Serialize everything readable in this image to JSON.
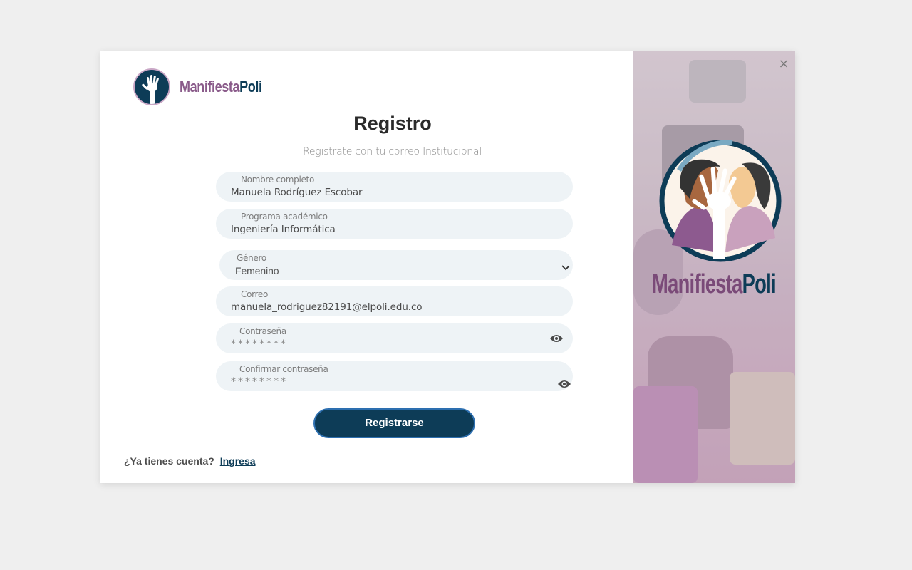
{
  "brand": {
    "name_part1": "Manifiesta",
    "name_part2": "Poli"
  },
  "title": "Registro",
  "subtitle": "Registrate con tu correo Institucional",
  "fields": {
    "full_name": {
      "label": "Nombre completo",
      "value": "Manuela Rodríguez Escobar"
    },
    "program": {
      "label": "Programa académico",
      "value": "Ingeniería Informática"
    },
    "gender": {
      "label": "Género",
      "value": "Femenino"
    },
    "email": {
      "label": "Correo",
      "value": "manuela_rodriguez82191@elpoli.edu.co"
    },
    "password": {
      "label": "Contraseña",
      "value": "********"
    },
    "confirm_password": {
      "label": "Confirmar contraseña",
      "value": "********"
    }
  },
  "submit_label": "Registrarse",
  "footer": {
    "prompt": "¿Ya tienes cuenta?",
    "link": "Ingresa"
  },
  "close_symbol": "×",
  "colors": {
    "navy": "#0d3c57",
    "purple": "#8a5b8a",
    "field_bg": "#eef3f6"
  }
}
